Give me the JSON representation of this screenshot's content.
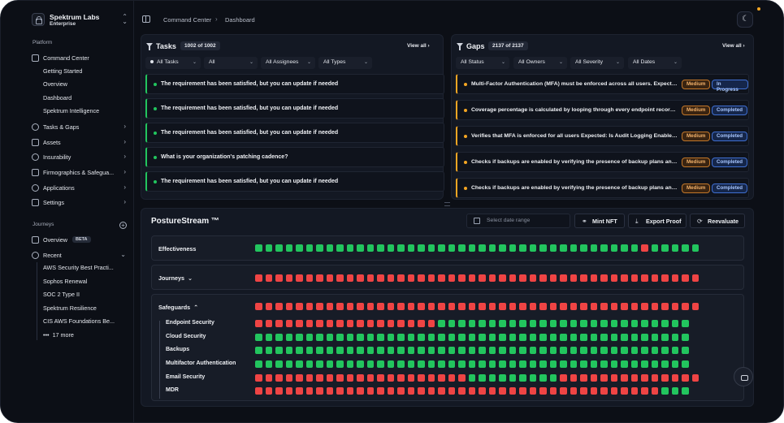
{
  "org": {
    "name": "Spektrum Labs",
    "plan": "Enterprise"
  },
  "sidebar": {
    "section_platform": "Platform",
    "command_center": "Command Center",
    "command_sub": [
      "Getting Started",
      "Overview",
      "Dashboard",
      "Spektrum Intelligence"
    ],
    "items": [
      {
        "label": "Tasks & Gaps"
      },
      {
        "label": "Assets"
      },
      {
        "label": "Insurability"
      },
      {
        "label": "Firmographics & Safegua..."
      },
      {
        "label": "Applications"
      },
      {
        "label": "Settings"
      }
    ],
    "section_journeys": "Journeys",
    "overview": "Overview",
    "beta": "BETA",
    "recent": "Recent",
    "recent_items": [
      "AWS Security Best Practi...",
      "Sophos Renewal",
      "SOC 2 Type II",
      "Spektrum Resilience",
      "CIS AWS Foundations Be..."
    ],
    "more": "17 more"
  },
  "breadcrumb": {
    "first": "Command Center",
    "second": "Dashboard"
  },
  "tasks": {
    "title": "Tasks",
    "count": "1002 of 1002",
    "view_all": "View all",
    "filters": [
      "All Tasks",
      "All",
      "All Assignees",
      "All Types"
    ],
    "rows": [
      "The requirement has been satisfied, but you can update if needed",
      "The requirement has been satisfied, but you can update if needed",
      "The requirement has been satisfied, but you can update if needed",
      "What is your organization's patching cadence?",
      "The requirement has been satisfied, but you can update if needed"
    ]
  },
  "gaps": {
    "title": "Gaps",
    "count": "2137 of 2137",
    "view_all": "View all",
    "filters": [
      "All Status",
      "All Owners",
      "All Severity",
      "All Dates"
    ],
    "rows": [
      {
        "text": "Multi-Factor Authentication (MFA) must be enforced across all users. Expected: All users should have MFA enabled",
        "severity": "Medium",
        "status": "In Progress"
      },
      {
        "text": "Coverage percentage is calculated by looping through every endpoint record and checking coverage",
        "severity": "Medium",
        "status": "Completed"
      },
      {
        "text": "Verifies that MFA is enforced for all users Expected: Is Audit Logging Enabled for all accounts",
        "severity": "Medium",
        "status": "Completed"
      },
      {
        "text": "Checks if backups are enabled by verifying the presence of backup plans and schedules",
        "severity": "Medium",
        "status": "Completed"
      },
      {
        "text": "Checks if backups are enabled by verifying the presence of backup plans and vaults",
        "severity": "Medium",
        "status": "Completed"
      }
    ]
  },
  "posture": {
    "title": "PostureStream ™",
    "date_placeholder": "Select date range",
    "buttons": {
      "mint": "Mint NFT",
      "export": "Export Proof",
      "reevaluate": "Reevaluate"
    },
    "colors": {
      "pass": "#22c55e",
      "fail": "#ef4444"
    },
    "effectiveness_label": "Effectiveness",
    "journeys_label": "Journeys",
    "safeguards_label": "Safeguards",
    "effectiveness": "ggggggggggggggggggggggggggggggggggggggrggggg",
    "journeys": "rrrrrrrrrrrrrrrrrrrrrrrrrrrrrrrrrrrrrrrrrrrr",
    "safeguards": "rrrrrrrrrrrrrrrrrrrrrrrrrrrrrrrrrrrrrrrrrrrr",
    "sub_rows": [
      {
        "label": "Endpoint Security",
        "pattern": "rrrrrrrrrrrrrrrrrrggggggggggggggggggggggggg"
      },
      {
        "label": "Cloud Security",
        "pattern": "ggggggggggggggggggggggggggggggggggggggggggg"
      },
      {
        "label": "Backups",
        "pattern": "ggggggggggggggggggggggggggggggggggggggggggg"
      },
      {
        "label": "Multifactor Authentication",
        "pattern": "ggggggggggggggggggggggggggggggggggggggggggg"
      },
      {
        "label": "Email Security",
        "pattern": "rrrrrrrrrrrrrrrrrrrrrgggggggggrrrrrrrrrrrrrr"
      },
      {
        "label": "MDR",
        "pattern": "rrrrrrrrrrrrrrrrrrrrrrrrrrrrrrrrrrrrrrrrggg"
      }
    ]
  }
}
